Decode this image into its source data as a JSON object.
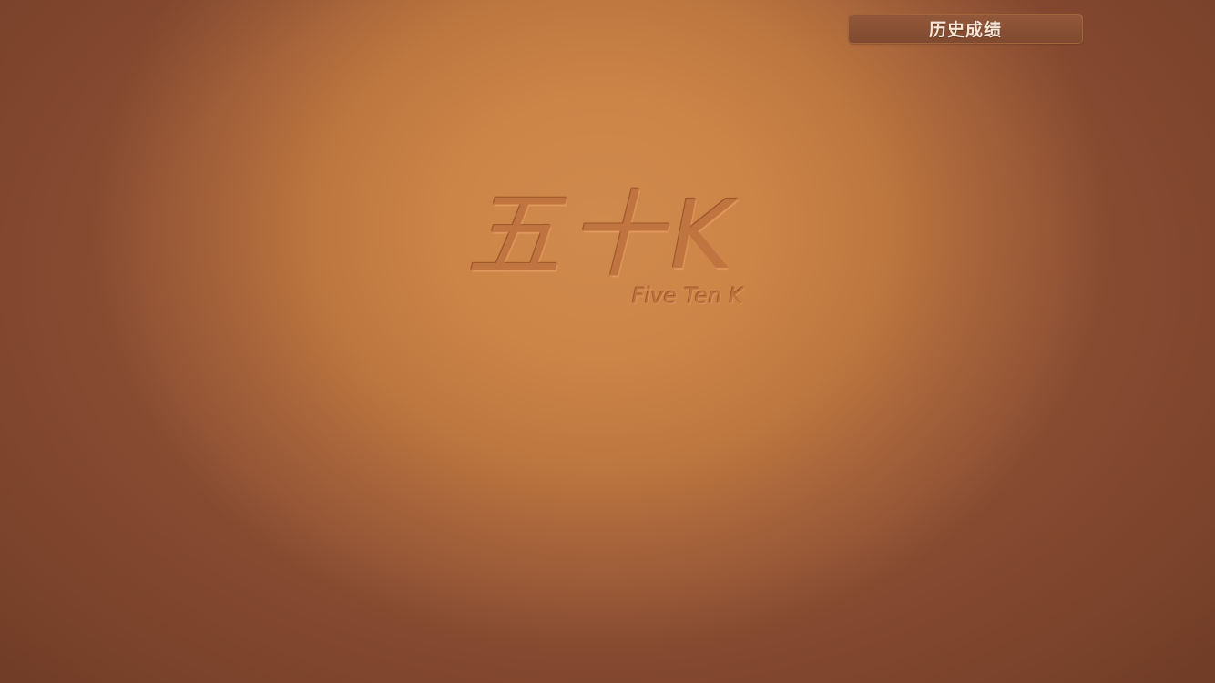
{
  "game": {
    "logo_chinese": "五十K",
    "logo_english": "Five Ten K"
  },
  "top_bar": {
    "history_button_label": "历史成绩"
  },
  "colors": {
    "table_center": "#d08a4d",
    "table_edge": "#7a4630",
    "button_background": "#8a5134",
    "button_text": "#f6e7d9",
    "logo_engraved": "#c0743f"
  }
}
